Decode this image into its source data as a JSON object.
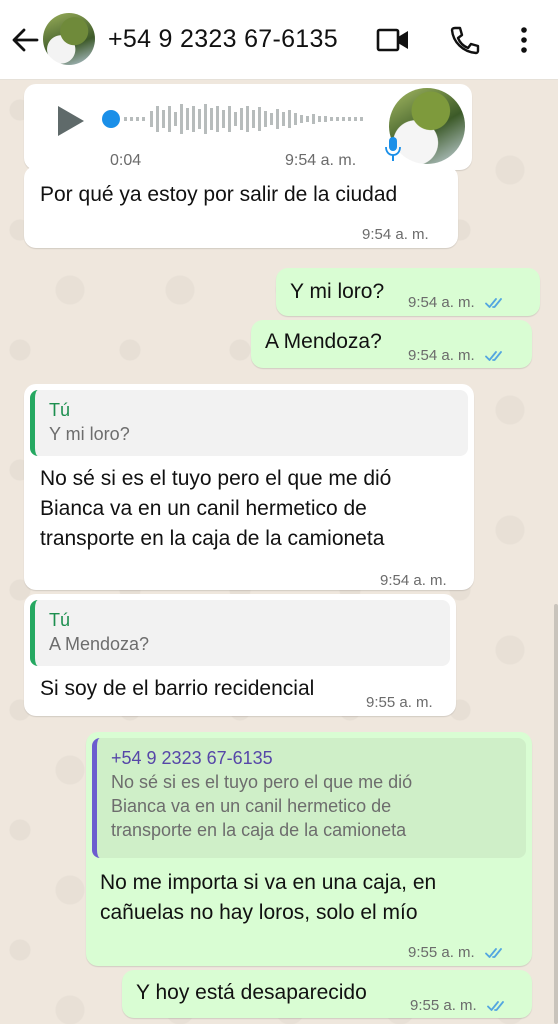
{
  "header": {
    "contact_name": "+54 9 2323 67-6135",
    "back_icon": "arrow-left-icon",
    "video_icon": "video-call-icon",
    "call_icon": "phone-icon",
    "menu_icon": "more-vertical-icon"
  },
  "colors": {
    "incoming_bubble": "#ffffff",
    "outgoing_bubble": "#d9fdd3",
    "read_ticks": "#53a6e0",
    "quote_bar_own": "#25a861",
    "quote_bar_contact": "#6c5ccf",
    "voice_dot": "#1a8fe8"
  },
  "messages": [
    {
      "type": "voice",
      "direction": "in",
      "duration": "0:04",
      "time": "9:54 a. m.",
      "progress": 0
    },
    {
      "direction": "in",
      "text": "Por qué ya estoy por salir de la ciudad",
      "time": "9:54 a. m."
    },
    {
      "direction": "out",
      "text": "Y mi loro?",
      "time": "9:54 a. m.",
      "status": "read"
    },
    {
      "direction": "out",
      "text": "A Mendoza?",
      "time": "9:54 a. m.",
      "status": "read"
    },
    {
      "direction": "in",
      "quote": {
        "author": "Tú",
        "text": "Y mi loro?"
      },
      "text_lines": [
        "No sé si es el tuyo pero el que me dió",
        "Bianca va en un canil hermetico de",
        "transporte en la caja de la camioneta"
      ],
      "time": "9:54 a. m."
    },
    {
      "direction": "in",
      "quote": {
        "author": "Tú",
        "text": "A Mendoza?"
      },
      "text": "Si soy de el barrio recidencial",
      "time": "9:55 a. m."
    },
    {
      "direction": "out",
      "quote": {
        "author": "+54 9 2323 67-6135",
        "text_lines": [
          "No sé si es el tuyo pero el que me dió",
          "Bianca va en un canil hermetico de",
          "transporte en la caja de la camioneta"
        ]
      },
      "text_lines": [
        "No me importa si va en una caja, en",
        "cañuelas no hay loros, solo el mío"
      ],
      "time": "9:55 a. m.",
      "status": "read"
    },
    {
      "direction": "out",
      "text": "Y hoy está desaparecido",
      "time": "9:55 a. m.",
      "status": "read"
    }
  ]
}
